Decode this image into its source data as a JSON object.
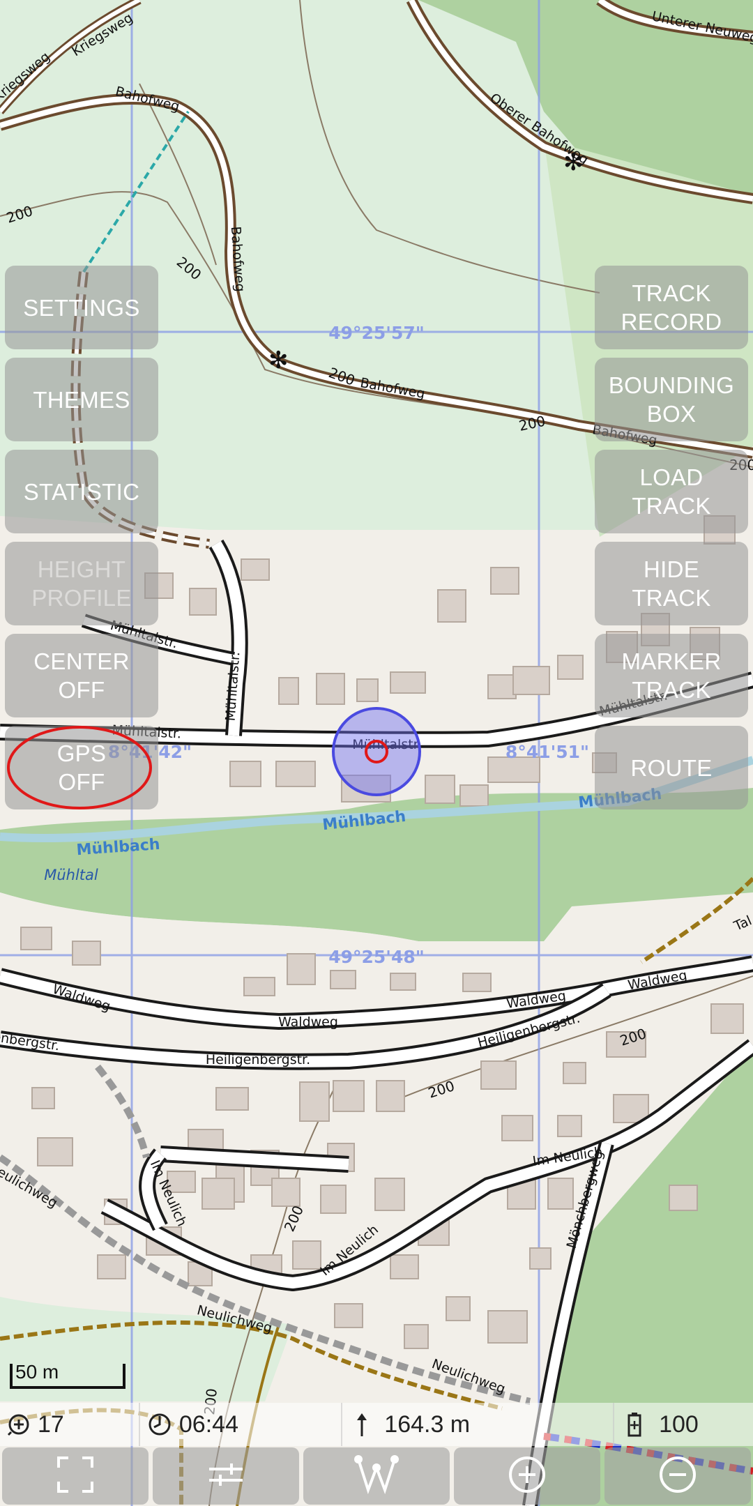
{
  "map": {
    "coord_labels": [
      "49°25'57\"",
      "49°25'48\"",
      "8°41'42\"",
      "8°41'51\""
    ],
    "street_labels": [
      "Kriegsweg",
      "Bahofweg",
      "Oberer Bahofweg",
      "Unterer Neuweg",
      "Mühltalstr.",
      "Mühlbach",
      "Mühltal",
      "Waldweg",
      "Heiligenbergstr.",
      "Im Neulich",
      "Neulichweg",
      "Mönchbergweg",
      "Tal"
    ],
    "contour_label": "200",
    "scale_label": "50 m",
    "colors": {
      "land": "#f2efe9",
      "meadow": "#ddeedd",
      "forest": "#aed1a0",
      "water": "#aad3df",
      "grid": "#8c9ee6",
      "position": "#5a5ae6"
    }
  },
  "left_buttons": [
    "SETTINGS",
    "THEMES",
    "STATISTIC",
    "HEIGHT\nPROFILE",
    "CENTER\nOFF",
    "GPS\nOFF"
  ],
  "right_buttons": [
    "TRACK\nRECORD",
    "BOUNDING\nBOX",
    "LOAD\nTRACK",
    "HIDE\nTRACK",
    "MARKER\nTRACK",
    "ROUTE"
  ],
  "status": {
    "zoom": "17",
    "time": "06:44",
    "altitude": "164.3 m",
    "battery": "100"
  },
  "bottom_bar_icons": [
    "fullscreen-icon",
    "sliders-icon",
    "waypoints-icon",
    "zoom-in-icon",
    "zoom-out-icon"
  ]
}
